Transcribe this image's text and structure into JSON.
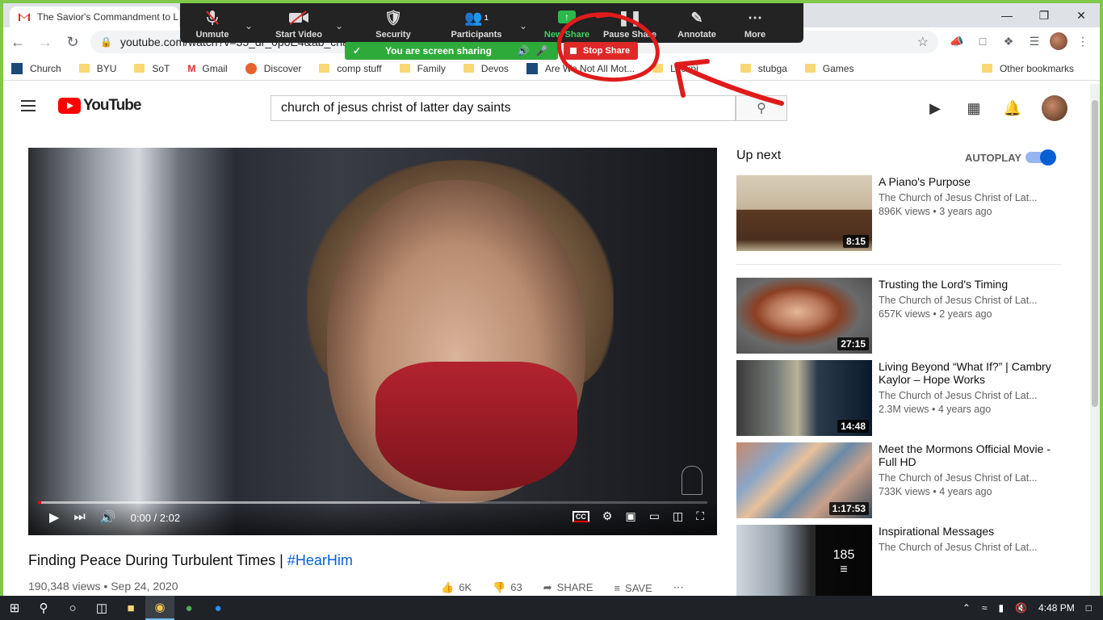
{
  "browser": {
    "tab_title": "The Savior's Commandment to L",
    "url": "youtube.com/watch?v=35_dr_0poE4&ab_chan",
    "bookmarks": [
      "Church",
      "BYU",
      "SoT",
      "Gmail",
      "Discover",
      "comp stuff",
      "Family",
      "Devos",
      "Are We Not All Mot...",
      "Lockpi",
      "stubga",
      "Games"
    ],
    "other_bookmarks": "Other bookmarks"
  },
  "zoom": {
    "items": [
      {
        "label": "Unmute",
        "icon": "mic-muted-icon"
      },
      {
        "label": "Start Video",
        "icon": "video-off-icon"
      },
      {
        "label": "Security",
        "icon": "shield-icon"
      },
      {
        "label": "Participants",
        "icon": "participants-icon",
        "count": "1"
      },
      {
        "label": "New Share",
        "icon": "share-icon"
      },
      {
        "label": "Pause Share",
        "icon": "pause-icon"
      },
      {
        "label": "Annotate",
        "icon": "pencil-icon"
      },
      {
        "label": "More",
        "icon": "more-icon"
      }
    ],
    "sharing_text": "You are screen sharing",
    "stop_share": "Stop Share",
    "accent_green": "#2eaa3a",
    "stop_red": "#e02828"
  },
  "youtube": {
    "logo": "YouTube",
    "search_value": "church of jesus christ of latter day saints",
    "player": {
      "time": "0:00 / 2:02",
      "buffered_fraction": 0.57
    },
    "video": {
      "title": "Finding Peace During Turbulent Times | ",
      "hashtag": "#HearHim",
      "views": "190,348 views",
      "date": "Sep 24, 2020",
      "likes": "6K",
      "dislikes": "63",
      "share": "SHARE",
      "save": "SAVE"
    },
    "up_next": "Up next",
    "autoplay": "AUTOPLAY",
    "recommendations": [
      {
        "title": "A Piano's Purpose",
        "channel": "The Church of Jesus Christ of Lat...",
        "meta": "896K views • 3 years ago",
        "duration": "8:15"
      },
      {
        "title": "Trusting the Lord's Timing",
        "channel": "The Church of Jesus Christ of Lat...",
        "meta": "657K views • 2 years ago",
        "duration": "27:15"
      },
      {
        "title": "Living Beyond “What If?” | Cambry Kaylor – Hope Works",
        "channel": "The Church of Jesus Christ of Lat...",
        "meta": "2.3M views • 4 years ago",
        "duration": "14:48"
      },
      {
        "title": "Meet the Mormons Official Movie - Full HD",
        "channel": "The Church of Jesus Christ of Lat...",
        "meta": "733K views • 4 years ago",
        "duration": "1:17:53"
      },
      {
        "title": "Inspirational Messages",
        "channel": "The Church of Jesus Christ of Lat...",
        "meta": "",
        "duration": "185"
      }
    ]
  },
  "taskbar": {
    "time": "4:48 PM"
  }
}
